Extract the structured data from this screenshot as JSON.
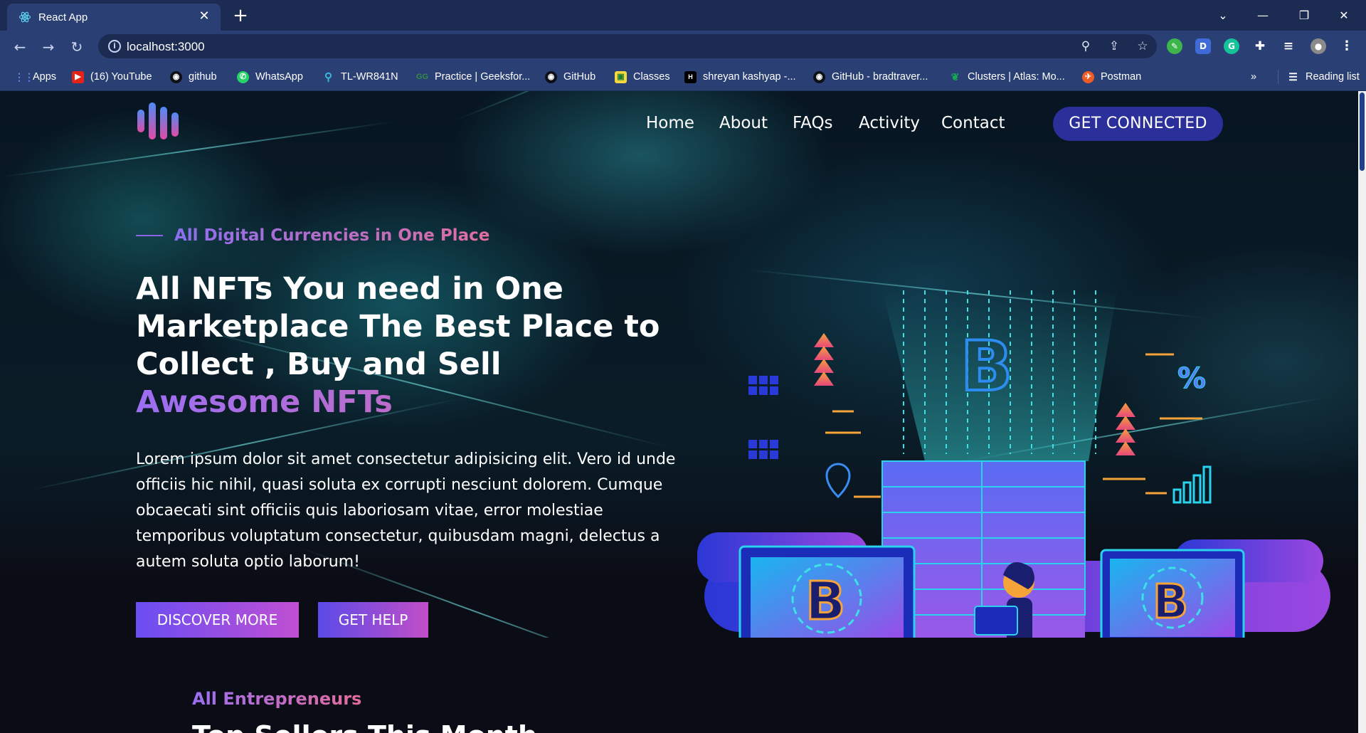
{
  "browser": {
    "tab_title": "React App",
    "url": "localhost:3000",
    "bookmarks": [
      {
        "label": "Apps",
        "color": "#5a8df0"
      },
      {
        "label": "(16) YouTube",
        "color": "#e62117"
      },
      {
        "label": "github",
        "color": "#1c2b52"
      },
      {
        "label": "WhatsApp",
        "color": "#25d366"
      },
      {
        "label": "TL-WR841N",
        "color": "#3cb9e0"
      },
      {
        "label": "Practice | Geeksfor...",
        "color": "#2f8d46"
      },
      {
        "label": "GitHub",
        "color": "#1c2b52"
      },
      {
        "label": "Classes",
        "color": "#f4d73c"
      },
      {
        "label": "shreyan kashyap -...",
        "color": "#000000"
      },
      {
        "label": "GitHub - bradtraver...",
        "color": "#1c2b52"
      },
      {
        "label": "Clusters | Atlas: Mo...",
        "color": "#13aa52"
      },
      {
        "label": "Postman",
        "color": "#ef5b25"
      }
    ],
    "bookmarks_overflow": "»",
    "reading_list": "Reading list"
  },
  "nav": {
    "links": [
      "Home",
      "About",
      "FAQs",
      "Activity",
      "Contact"
    ],
    "cta": "GET CONNECTED"
  },
  "hero": {
    "eyebrow": "All Digital Currencies in One Place",
    "headline_lines": [
      "All NFTs You need in One",
      "Marketplace The Best Place to",
      "Collect , Buy and Sell"
    ],
    "headline_accent": "Awesome NFTs",
    "description": "Lorem ipsum dolor sit amet consectetur adipisicing elit. Vero id unde officiis hic nihil, quasi soluta ex corrupti nesciunt dolorem. Cumque obcaecati sint officiis quis laboriosam vitae, error molestiae temporibus voluptatum consectetur, quibusdam magni, delectus a autem soluta optio laborum!",
    "buttons": {
      "discover": "DISCOVER MORE",
      "help": "GET HELP"
    }
  },
  "section": {
    "subtitle": "All Entrepreneurs",
    "title": "Top Sellers This Month"
  },
  "illustration": {
    "symbol_currency": "B",
    "symbol_percent": "%"
  }
}
